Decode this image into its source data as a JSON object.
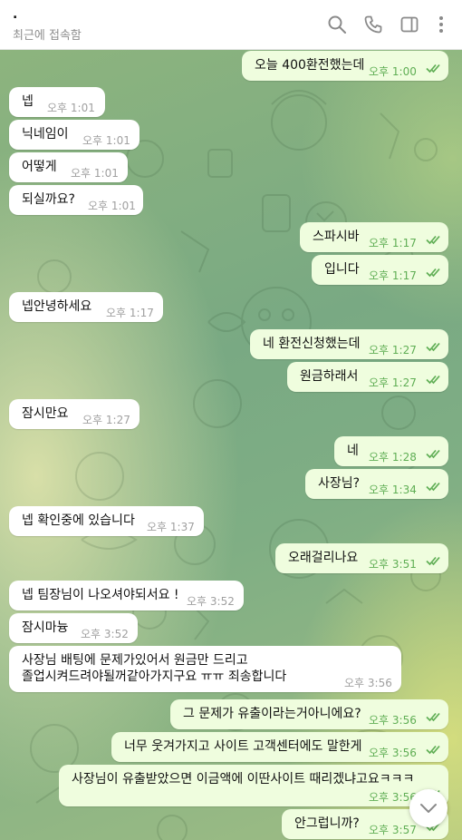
{
  "header": {
    "contact_name": ".",
    "status": "최근에 접속함",
    "icons": [
      "search-icon",
      "phone-icon",
      "sidebar-toggle-icon",
      "more-vertical-icon"
    ]
  },
  "colors": {
    "incoming_bubble": "#ffffff",
    "outgoing_bubble": "#effdde",
    "outgoing_time": "#5fae54",
    "incoming_time": "#a0a0a0"
  },
  "messages": [
    {
      "dir": "out",
      "text": "오늘 400환전했는데",
      "time": "오후 1:00",
      "read": true
    },
    {
      "dir": "in",
      "text": "넵",
      "time": "오후 1:01"
    },
    {
      "dir": "in",
      "text": "닉네임이",
      "time": "오후 1:01"
    },
    {
      "dir": "in",
      "text": "어떻게",
      "time": "오후 1:01"
    },
    {
      "dir": "in",
      "text": "되실까요?",
      "time": "오후 1:01"
    },
    {
      "dir": "out",
      "text": "스파시바",
      "time": "오후 1:17",
      "read": true
    },
    {
      "dir": "out",
      "text": "입니다",
      "time": "오후 1:17",
      "read": true
    },
    {
      "dir": "in",
      "text": "넵안녕하세요",
      "time": "오후 1:17"
    },
    {
      "dir": "out",
      "text": "네 환전신청했는데",
      "time": "오후 1:27",
      "read": true
    },
    {
      "dir": "out",
      "text": "원금하래서",
      "time": "오후 1:27",
      "read": true
    },
    {
      "dir": "in",
      "text": "잠시만요",
      "time": "오후 1:27"
    },
    {
      "dir": "out",
      "text": "네",
      "time": "오후 1:28",
      "read": true
    },
    {
      "dir": "out",
      "text": "사장님?",
      "time": "오후 1:34",
      "read": true
    },
    {
      "dir": "in",
      "text": "넵 확인중에 있습니다",
      "time": "오후 1:37"
    },
    {
      "dir": "out",
      "text": "오래걸리나요",
      "time": "오후 3:51",
      "read": true
    },
    {
      "dir": "in",
      "text": "넵 팀장님이 나오셔야되서요 !",
      "time": "오후 3:52"
    },
    {
      "dir": "in",
      "text": "잠시마늉",
      "time": "오후 3:52"
    },
    {
      "dir": "in",
      "text": "사장님 배팅에 문제가있어서 원금만 드리고",
      "text2": "졸업시켜드려야될꺼같아가지구요 ㅠㅠ 죄송합니다",
      "time": "오후 3:56"
    },
    {
      "dir": "out",
      "text": "그 문제가 유출이라는거아니에요?",
      "time": "오후 3:56",
      "read": true
    },
    {
      "dir": "out",
      "text": "너무 웃겨가지고 사이트 고객센터에도 말한게",
      "time": "오후 3:56",
      "read": true
    },
    {
      "dir": "out",
      "text": "사장님이 유출받았으면 이금액에 이딴사이트 때리겠냐고요ㅋㅋㅋ",
      "time": "오후 3:56",
      "read": true
    },
    {
      "dir": "out",
      "text": "안그럽니까?",
      "time": "오후 3:57",
      "read": true
    }
  ],
  "scroll_down_icon": "chevron-down-icon"
}
